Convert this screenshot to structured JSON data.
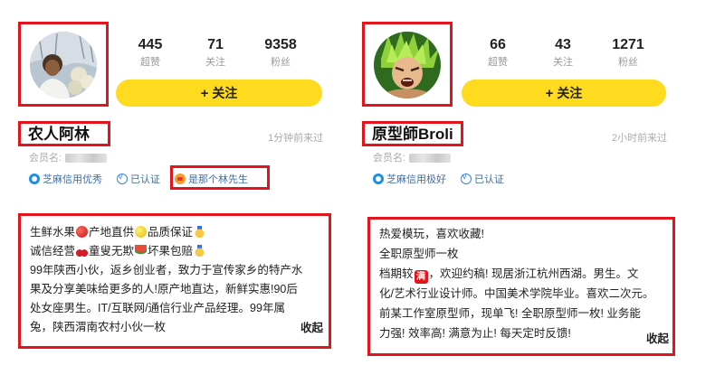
{
  "left_profile": {
    "stats": [
      {
        "num": "445",
        "label": "超赞"
      },
      {
        "num": "71",
        "label": "关注"
      },
      {
        "num": "9358",
        "label": "粉丝"
      }
    ],
    "follow_label": "关注",
    "name": "农人阿林",
    "time": "1分钟前来过",
    "member_label": "会员名:",
    "badges": [
      "芝麻信用优秀",
      "已认证",
      "是那个林先生"
    ],
    "bio_lines": [
      [
        "生鲜水果",
        "产地直供",
        "品质保证"
      ],
      [
        "诚信经营",
        "童叟无欺",
        "坏果包赔"
      ],
      [
        "99年陕西小伙，返乡创业者，致力于宣传家乡的特产水"
      ],
      [
        "果及分享美味给更多的人!原产地直达，新鲜实惠!90后"
      ],
      [
        "处女座男生。IT/互联网/通信行业产品经理。99年属"
      ],
      [
        "兔，陕西渭南农村小伙一枚"
      ]
    ],
    "collapse_label": "收起"
  },
  "right_profile": {
    "stats": [
      {
        "num": "66",
        "label": "超赞"
      },
      {
        "num": "43",
        "label": "关注"
      },
      {
        "num": "1271",
        "label": "粉丝"
      }
    ],
    "follow_label": "关注",
    "name": "原型師Broli",
    "time": "2小时前来过",
    "member_label": "会员名:",
    "badges": [
      "芝麻信用极好",
      "已认证"
    ],
    "bio_lines": [
      [
        "热爱模玩，喜欢收藏!"
      ],
      [
        "全职原型师一枚"
      ],
      [
        "档期较",
        "满",
        "，欢迎约稿! 现居浙江杭州西湖。男生。文"
      ],
      [
        "化/艺术行业设计师。中国美术学院毕业。喜欢二次元。"
      ],
      [
        "前某工作室原型师，现单飞! 全职原型师一枚! 业务能"
      ],
      [
        "力强! 效率高! 满意为止! 每天定时反馈!"
      ]
    ],
    "collapse_label": "收起"
  },
  "icons": {
    "avatar_left": "person-in-orchard-photo",
    "avatar_right": "anime-character-portrait",
    "emoji": [
      "apple-emoji",
      "lemon-emoji",
      "medal-emoji",
      "cherry-emoji",
      "watermelon-emoji"
    ]
  },
  "colors": {
    "highlight_border": "#e3141b",
    "follow_button": "#fedb1e",
    "badge_text": "#3f6ea7"
  }
}
